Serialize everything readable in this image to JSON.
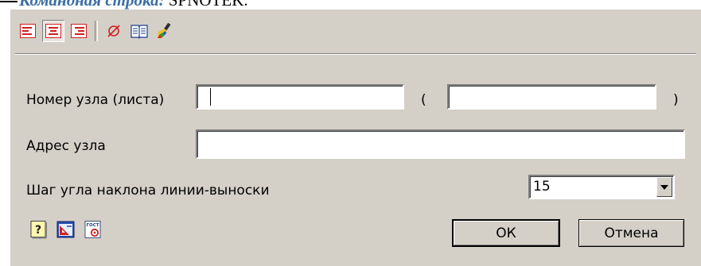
{
  "caption": {
    "italic_text": "Командная строка:",
    "command": "SPNOTEK."
  },
  "toolbar": {
    "buttons": [
      {
        "icon": "align-left-icon",
        "pressed": false
      },
      {
        "icon": "align-center-icon",
        "pressed": true
      },
      {
        "icon": "align-right-icon",
        "pressed": false
      },
      {
        "icon": "diameter-symbol-icon",
        "pressed": false
      },
      {
        "icon": "book-icon",
        "pressed": false
      },
      {
        "icon": "brush-icon",
        "pressed": false
      }
    ]
  },
  "form": {
    "node_number_label": "Номер узла (листа)",
    "node_number_value": "",
    "paren_open": "(",
    "sheet_value": "",
    "paren_close": ")",
    "node_address_label": "Адрес узла",
    "node_address_value": "",
    "angle_step_label": "Шаг угла наклона линии-выноски",
    "angle_step_value": "15"
  },
  "buttons": {
    "ok": "ОК",
    "cancel": "Отмена"
  },
  "colors": {
    "dialog_bg": "#d4d0c8",
    "field_bg": "#ffffff",
    "caption_italic": "#3a6ea5"
  }
}
